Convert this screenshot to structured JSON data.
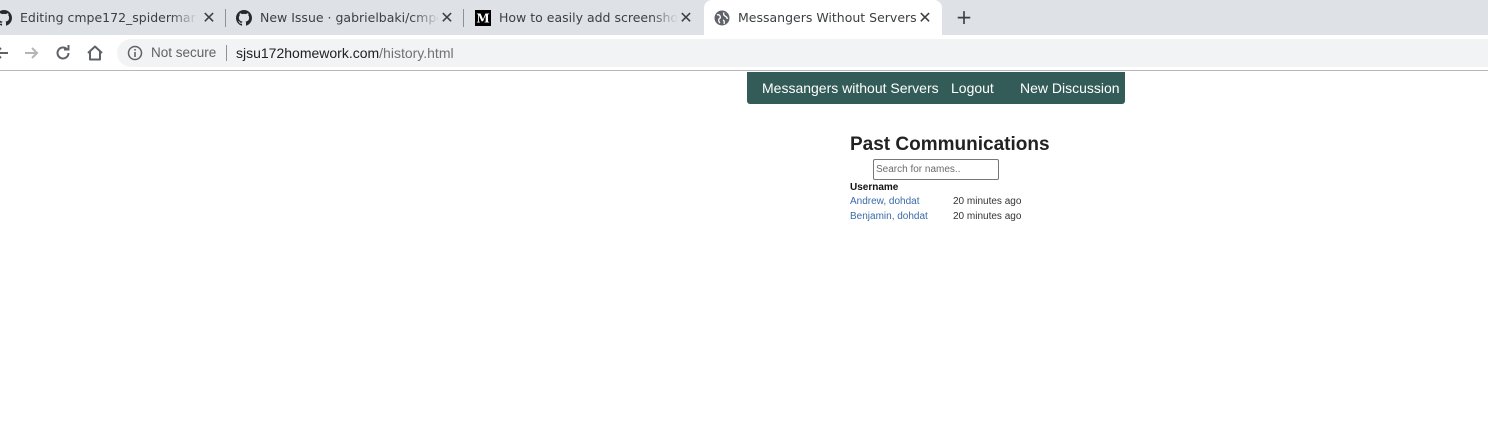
{
  "browser": {
    "tabs": [
      {
        "title": "Editing cmpe172_spiderman/README",
        "favicon": "github-icon",
        "active": false
      },
      {
        "title": "New Issue · gabrielbaki/cmpe172",
        "favicon": "github-icon",
        "active": false
      },
      {
        "title": "How to easily add screenshots into",
        "favicon": "medium-icon",
        "active": false
      },
      {
        "title": "Messangers Without Servers!",
        "favicon": "globe-icon",
        "active": true
      }
    ],
    "security_label": "Not secure",
    "url_host": "sjsu172homework.com",
    "url_path": "/history.html"
  },
  "navbar": {
    "brand": "Messangers without Servers",
    "logout": "Logout",
    "new_discussion": "New Discussion",
    "color": "#335c58"
  },
  "history": {
    "heading": "Past Communications",
    "search_placeholder": "Search for names..",
    "column_header": "Username",
    "rows": [
      {
        "name": "Andrew, dohdat",
        "time": "20 minutes ago"
      },
      {
        "name": "Benjamin, dohdat",
        "time": "20 minutes ago"
      }
    ]
  }
}
